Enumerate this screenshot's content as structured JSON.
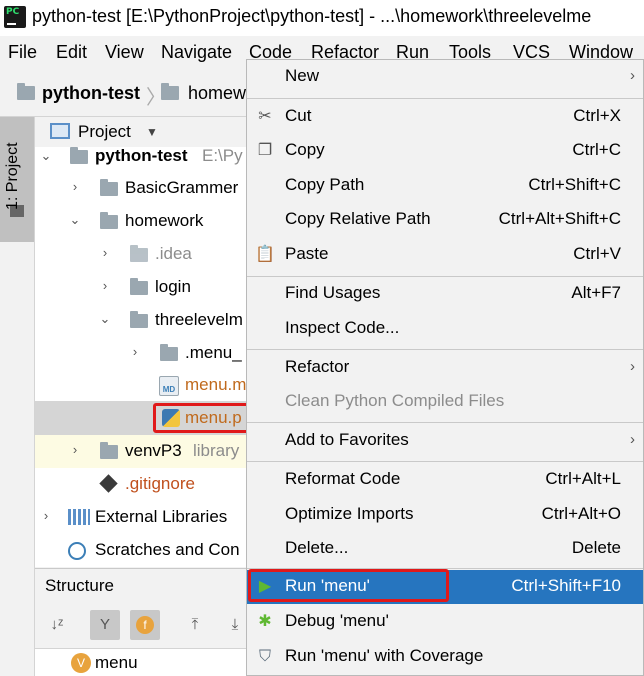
{
  "window": {
    "title": "python-test [E:\\PythonProject\\python-test] - ...\\homework\\threelevelme"
  },
  "menubar": [
    "File",
    "Edit",
    "View",
    "Navigate",
    "Code",
    "Refactor",
    "Run",
    "Tools",
    "VCS",
    "Window"
  ],
  "navbar": {
    "crumb1": "python-test",
    "crumb2": "homew"
  },
  "side_strip": {
    "tab_label": "1: Project"
  },
  "project_panel": {
    "title": "Project"
  },
  "tree": [
    {
      "name": "python-test",
      "suffix": "E:\\Py"
    },
    {
      "name": "BasicGrammer"
    },
    {
      "name": "homework"
    },
    {
      "name": ".idea"
    },
    {
      "name": "login"
    },
    {
      "name": "threelevelm"
    },
    {
      "name": ".menu_"
    },
    {
      "name": "menu.m"
    },
    {
      "name": "menu.p"
    },
    {
      "name": "venvP3",
      "suffix": "library"
    },
    {
      "name": ".gitignore"
    },
    {
      "name": "External Libraries"
    },
    {
      "name": "Scratches and Con"
    }
  ],
  "structure": {
    "title": "Structure",
    "item": "menu"
  },
  "context_menu": {
    "items": [
      {
        "label": "New",
        "shortcut": ""
      },
      {
        "label": "Cut",
        "shortcut": "Ctrl+X"
      },
      {
        "label": "Copy",
        "shortcut": "Ctrl+C"
      },
      {
        "label": "Copy Path",
        "shortcut": "Ctrl+Shift+C"
      },
      {
        "label": "Copy Relative Path",
        "shortcut": "Ctrl+Alt+Shift+C"
      },
      {
        "label": "Paste",
        "shortcut": "Ctrl+V"
      },
      {
        "label": "Find Usages",
        "shortcut": "Alt+F7"
      },
      {
        "label": "Inspect Code...",
        "shortcut": ""
      },
      {
        "label": "Refactor",
        "shortcut": ""
      },
      {
        "label": "Clean Python Compiled Files",
        "shortcut": ""
      },
      {
        "label": "Add to Favorites",
        "shortcut": ""
      },
      {
        "label": "Reformat Code",
        "shortcut": "Ctrl+Alt+L"
      },
      {
        "label": "Optimize Imports",
        "shortcut": "Ctrl+Alt+O"
      },
      {
        "label": "Delete...",
        "shortcut": "Delete"
      },
      {
        "label": "Run 'menu'",
        "shortcut": "Ctrl+Shift+F10"
      },
      {
        "label": "Debug 'menu'",
        "shortcut": ""
      },
      {
        "label": "Run 'menu' with Coverage",
        "shortcut": ""
      }
    ]
  },
  "colors": {
    "selection": "#2675bf",
    "highlight_box": "#e0191a",
    "folder": "#9aa7b0",
    "ignored_file": "#c0501d"
  }
}
